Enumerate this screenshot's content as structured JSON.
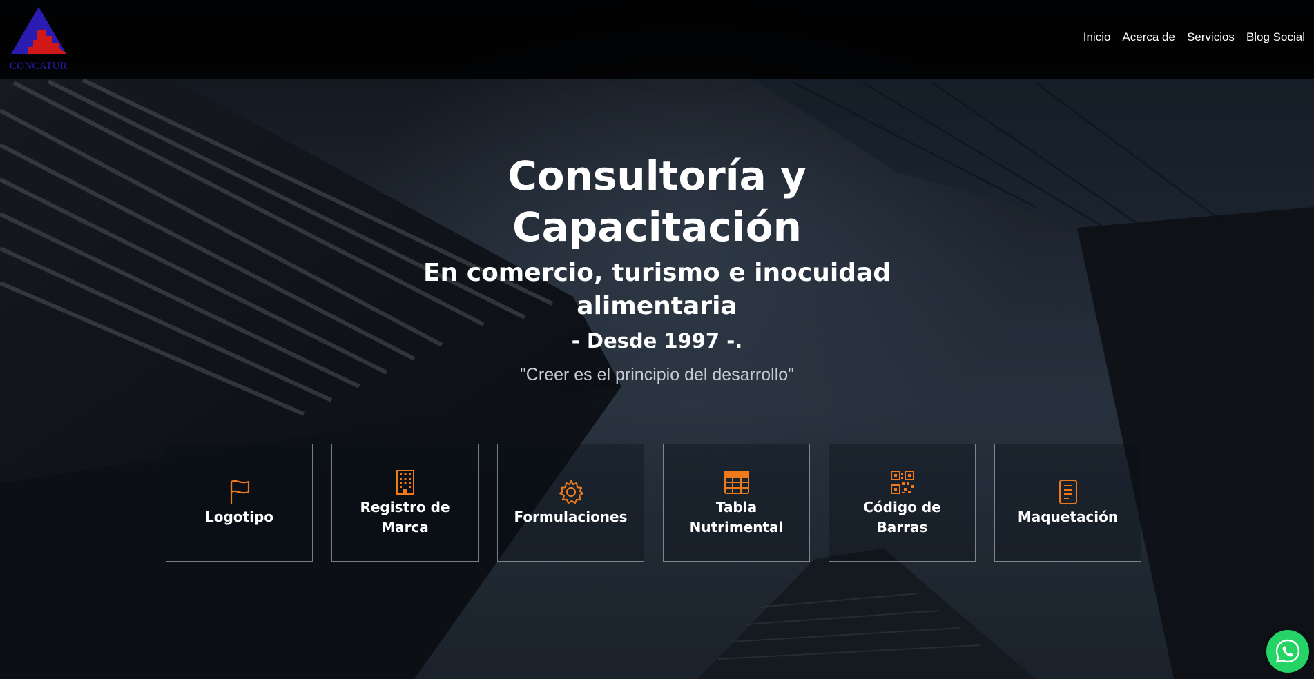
{
  "brand": {
    "logo_text": "CONCATUR",
    "colors": {
      "blue": "#2a1cb0",
      "red": "#d01818",
      "accent": "#f07a1a",
      "whatsapp": "#25d366"
    }
  },
  "nav": {
    "items": [
      {
        "label": "Inicio"
      },
      {
        "label": "Acerca de"
      },
      {
        "label": "Servicios"
      },
      {
        "label": "Blog Social"
      }
    ]
  },
  "hero": {
    "title_line1": "Consultoría y",
    "title_line2": "Capacitación",
    "subtitle_line1": "En comercio, turismo e inocuidad",
    "subtitle_line2": "alimentaria",
    "since": "- Desde 1997 -.",
    "quote": "\"Creer es el principio del desarrollo\""
  },
  "services": [
    {
      "label": "Logotipo",
      "icon": "flag-icon"
    },
    {
      "label": "Registro de Marca",
      "icon": "building-icon"
    },
    {
      "label": "Formulaciones",
      "icon": "gear-icon"
    },
    {
      "label": "Tabla Nutrimental",
      "icon": "table-icon"
    },
    {
      "label": "Código de Barras",
      "icon": "qr-code-icon"
    },
    {
      "label": "Maquetación",
      "icon": "document-icon"
    }
  ],
  "whatsapp": {
    "icon": "whatsapp-icon"
  }
}
